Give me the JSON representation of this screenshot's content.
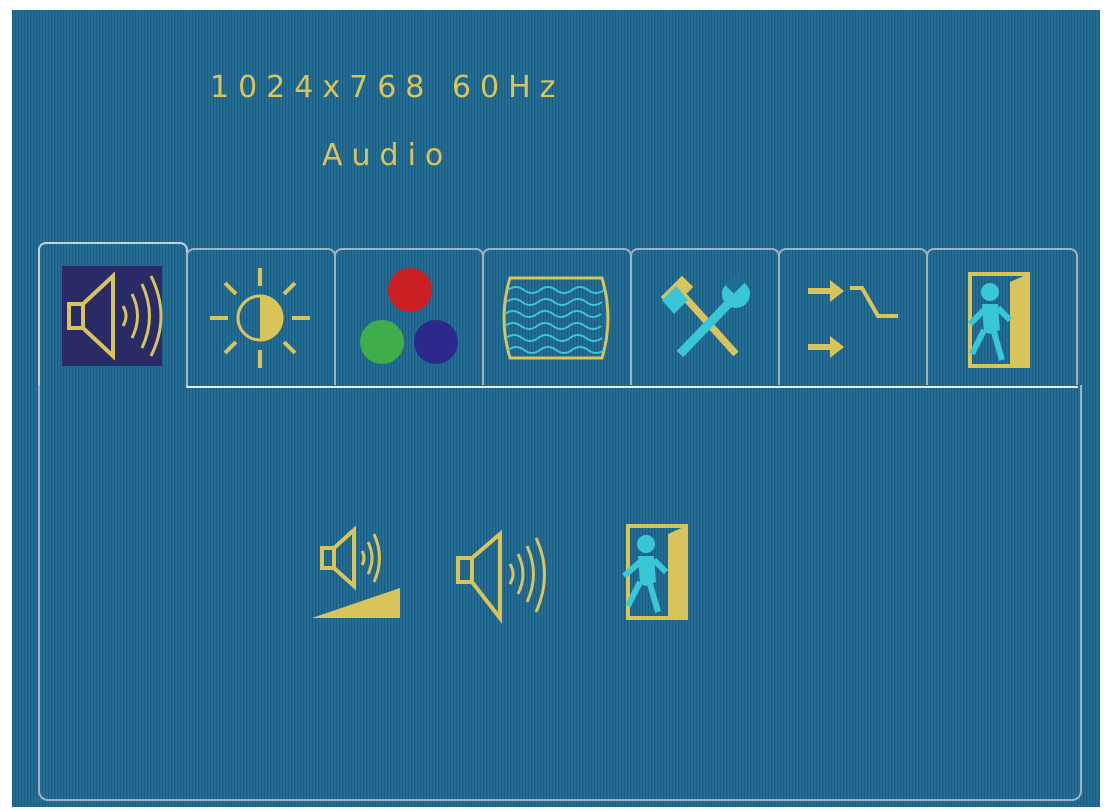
{
  "osd": {
    "resolution": "1024x768 60Hz",
    "menu_title": "Audio"
  },
  "tabs": [
    {
      "id": "audio",
      "icon": "speaker-icon",
      "active": true
    },
    {
      "id": "brightness",
      "icon": "brightness-sun-icon",
      "active": false
    },
    {
      "id": "color",
      "icon": "rgb-dots-icon",
      "active": false
    },
    {
      "id": "image",
      "icon": "wave-screen-icon",
      "active": false
    },
    {
      "id": "tools",
      "icon": "hammer-wrench-icon",
      "active": false
    },
    {
      "id": "input",
      "icon": "input-switch-icon",
      "active": false
    },
    {
      "id": "exit",
      "icon": "exit-door-icon",
      "active": false
    }
  ],
  "submenu": [
    {
      "id": "volume",
      "icon": "volume-level-icon"
    },
    {
      "id": "mute",
      "icon": "speaker-icon"
    },
    {
      "id": "exit",
      "icon": "exit-door-icon"
    }
  ],
  "colors": {
    "background": "#1f6c96",
    "text": "#d8c45a",
    "icon_yellow": "#d8c45a",
    "icon_cyan": "#39c6d6",
    "selected_tab_bg": "#2a2a66",
    "border": "#9fb2c0"
  }
}
